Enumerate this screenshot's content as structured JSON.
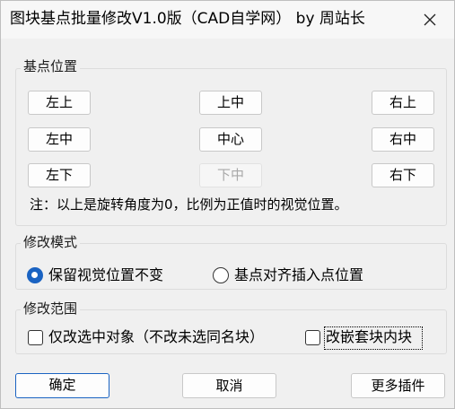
{
  "window": {
    "title": "图块基点批量修改V1.0版（CAD自学网） by 周站长"
  },
  "base_point": {
    "legend": "基点位置",
    "buttons": {
      "top_left": "左上",
      "top_center": "上中",
      "top_right": "右上",
      "middle_left": "左中",
      "center": "中心",
      "middle_right": "右中",
      "bottom_left": "左下",
      "bottom_center": "下中",
      "bottom_right": "右下"
    },
    "note": "注：以上是旋转角度为0，比例为正值时的视觉位置。"
  },
  "mode": {
    "legend": "修改模式",
    "option_keep_visual": "保留视觉位置不变",
    "option_align_insert": "基点对齐插入点位置",
    "selected": "keep_visual"
  },
  "scope": {
    "legend": "修改范围",
    "option_selected_only": "仅改选中对象（不改未选同名块）",
    "option_nested": "改嵌套块内块",
    "selected_only_checked": false,
    "nested_checked": false
  },
  "footer": {
    "ok": "确定",
    "cancel": "取消",
    "more_plugins": "更多插件"
  }
}
